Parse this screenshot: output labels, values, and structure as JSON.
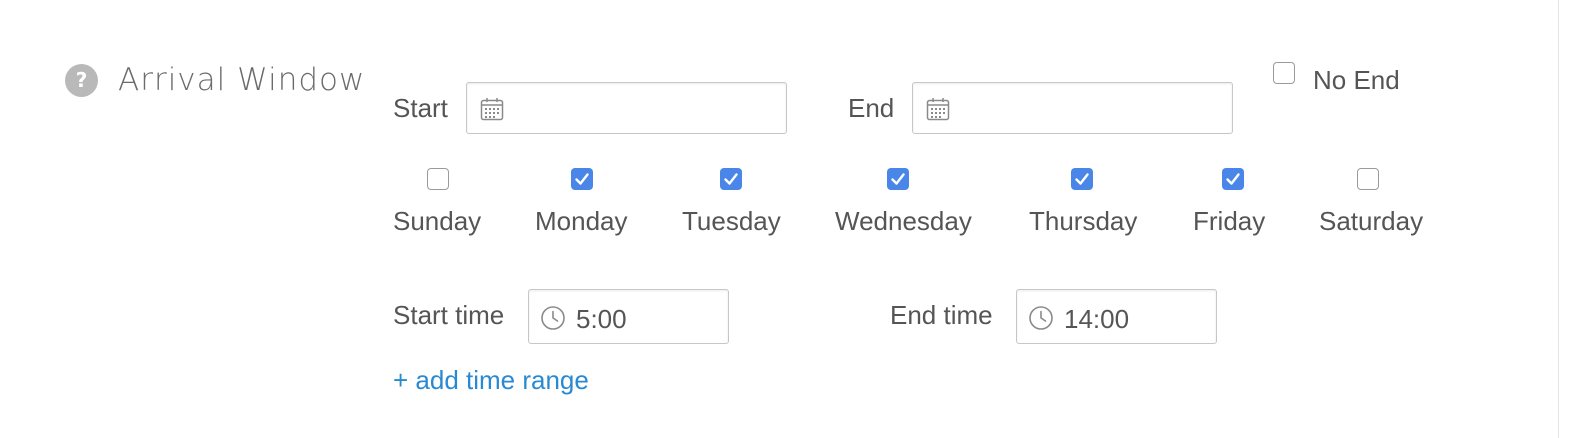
{
  "section": {
    "title": "Arrival Window",
    "help_symbol": "?"
  },
  "dates": {
    "start_label": "Start",
    "start_value": "",
    "end_label": "End",
    "end_value": "",
    "no_end_label": "No End",
    "no_end_checked": false
  },
  "days": [
    {
      "label": "Sunday",
      "checked": false
    },
    {
      "label": "Monday",
      "checked": true
    },
    {
      "label": "Tuesday",
      "checked": true
    },
    {
      "label": "Wednesday",
      "checked": true
    },
    {
      "label": "Thursday",
      "checked": true
    },
    {
      "label": "Friday",
      "checked": true
    },
    {
      "label": "Saturday",
      "checked": false
    }
  ],
  "times": {
    "start_label": "Start time",
    "start_value": "5:00",
    "end_label": "End time",
    "end_value": "14:00"
  },
  "add_time_range_label": "+ add time range",
  "icons": {
    "help": "help-question-icon",
    "date": "calendar-icon",
    "time": "clock-icon",
    "check": "checkmark-icon"
  },
  "colors": {
    "checkbox_checked": "#4a86e8",
    "link": "#2a8ad1",
    "text": "#555555",
    "help_icon": "#b9b9b9"
  }
}
